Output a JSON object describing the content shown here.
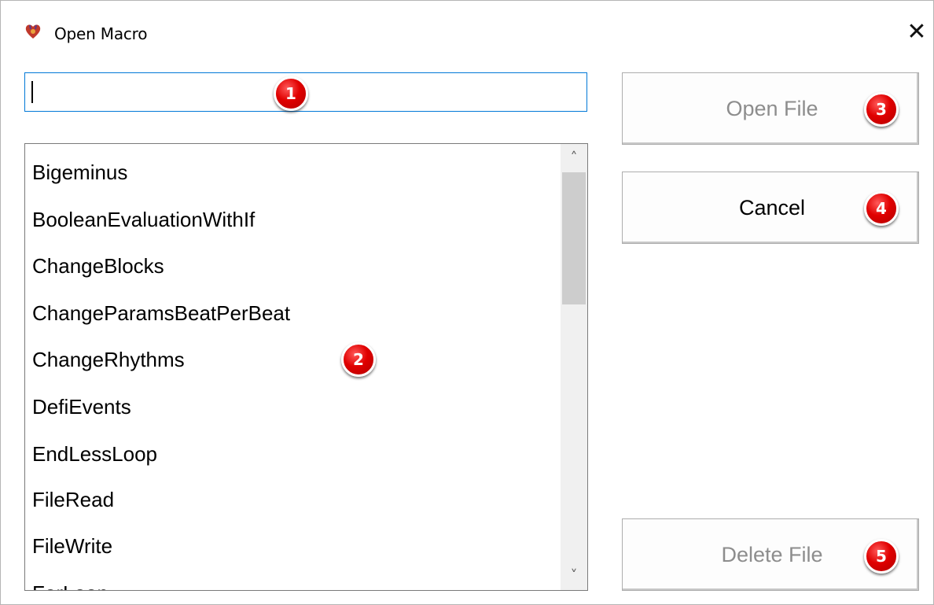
{
  "window": {
    "title": "Open Macro",
    "close_glyph": "✕",
    "icon": "app-heart-icon"
  },
  "search": {
    "value": "",
    "placeholder": ""
  },
  "macro_list": {
    "items": [
      "Bigeminus",
      "BooleanEvaluationWithIf",
      "ChangeBlocks",
      "ChangeParamsBeatPerBeat",
      "ChangeRhythms",
      "DefiEvents",
      "EndLessLoop",
      "FileRead",
      "FileWrite",
      "ForLoop"
    ],
    "scroll_up_glyph": "˄",
    "scroll_down_glyph": "˅"
  },
  "buttons": {
    "open_file": "Open File",
    "cancel": "Cancel",
    "delete_file": "Delete File"
  },
  "callouts": [
    "1",
    "2",
    "3",
    "4",
    "5"
  ],
  "colors": {
    "focus_border": "#0078d7",
    "callout": "#e00000",
    "disabled_text": "#8d8d8d"
  }
}
